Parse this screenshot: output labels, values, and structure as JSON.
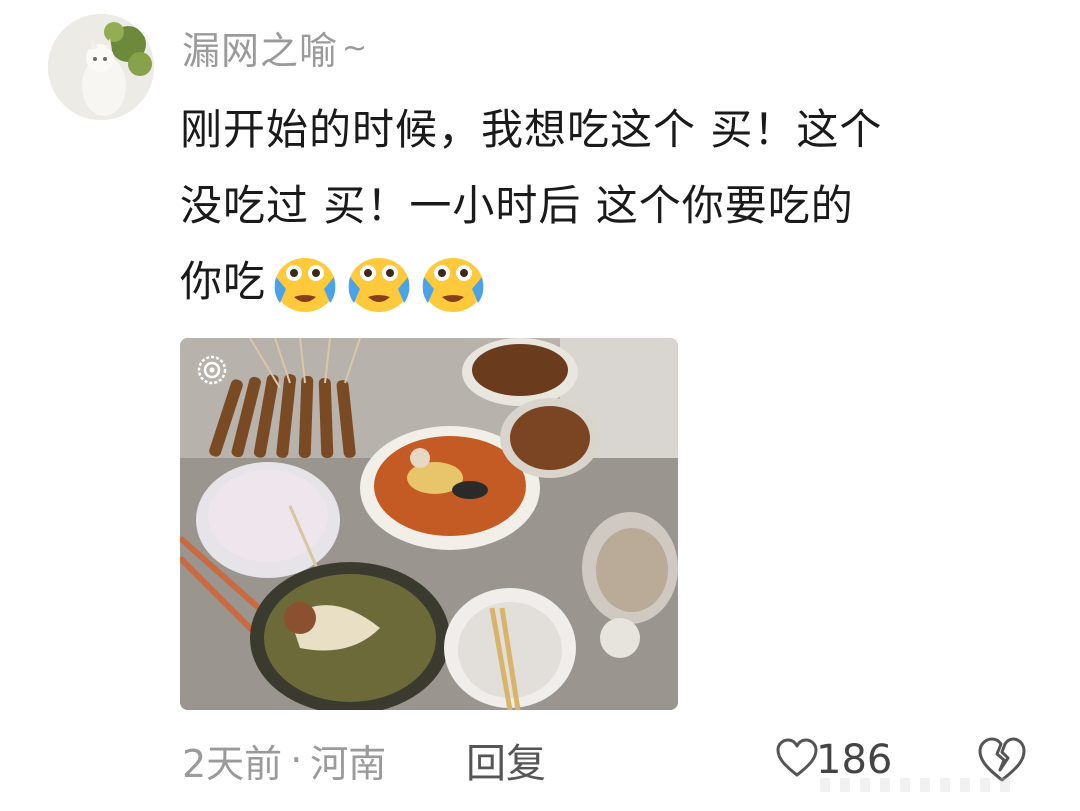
{
  "comment": {
    "username": "漏网之喻",
    "text_lines": [
      "刚开始的时候，我想吃这个 买！这个",
      "没吃过 买！一小时后 这个你要吃的",
      "你吃"
    ],
    "emojis": [
      "crying-laugh-emoji",
      "crying-laugh-emoji",
      "crying-laugh-emoji"
    ],
    "time": "2天前",
    "separator": "·",
    "location": "河南",
    "reply_label": "回复",
    "like_count": "186"
  },
  "icons": {
    "username_suffix": "tilde-icon",
    "like": "heart-outline-icon",
    "dislike": "broken-heart-icon",
    "photo_badge": "live-photo-icon"
  },
  "colors": {
    "meta_gray": "#9a9a9a",
    "text": "#1a1a1a",
    "emoji_face": "#ffc93c",
    "emoji_tear": "#4aa3e8"
  }
}
